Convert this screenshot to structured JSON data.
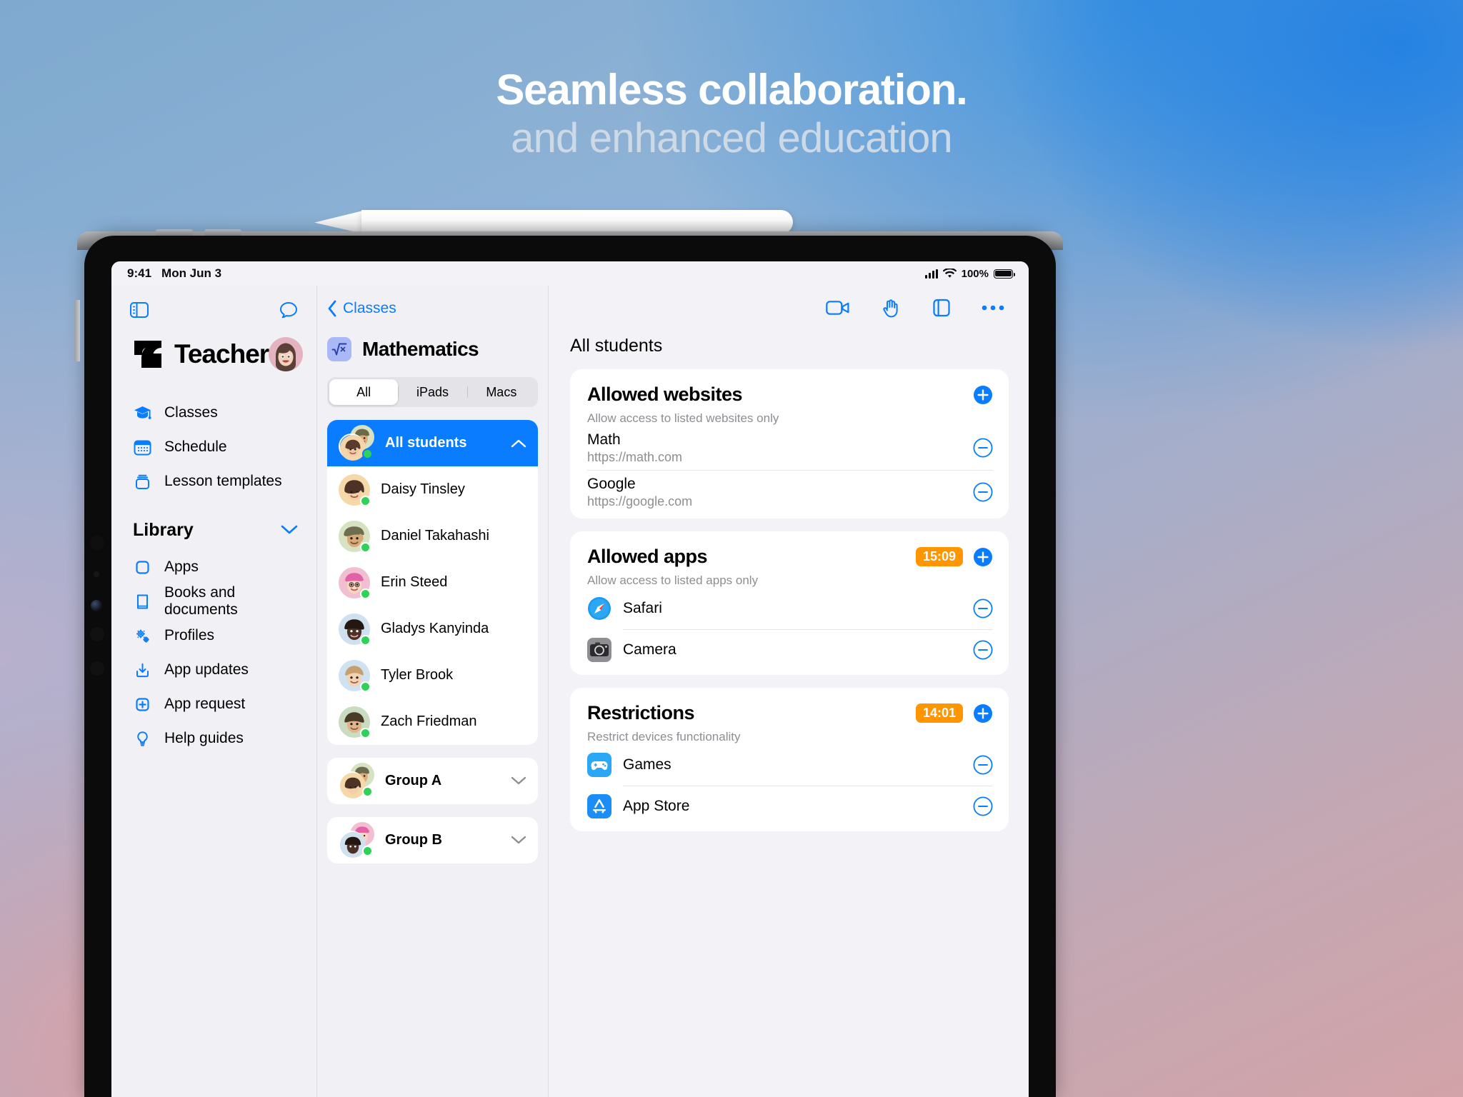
{
  "marketing": {
    "headline_line1": "Seamless collaboration.",
    "headline_line2": "and enhanced education"
  },
  "statusbar": {
    "time": "9:41",
    "date": "Mon Jun 3",
    "battery_percent": "100%",
    "wifi_icon": "wifi-icon",
    "cellular_icon": "signal-bars-icon",
    "battery_icon": "battery-full-icon"
  },
  "sidebar": {
    "toggle_icon": "sidebar-toggle-icon",
    "messages_icon": "message-bubble-icon",
    "brand_name": "Teacher",
    "brand_logo_icon": "teacher-app-logo-icon",
    "avatar_icon": "teacher-avatar",
    "items": [
      {
        "label": "Classes",
        "icon": "graduation-cap-icon"
      },
      {
        "label": "Schedule",
        "icon": "calendar-icon"
      },
      {
        "label": "Lesson templates",
        "icon": "lesson-templates-icon"
      }
    ],
    "library_header": "Library",
    "library_chevron_icon": "chevron-down-icon",
    "library_items": [
      {
        "label": "Apps",
        "icon": "app-square-icon"
      },
      {
        "label": "Books and documents",
        "icon": "book-icon"
      },
      {
        "label": "Profiles",
        "icon": "gears-icon"
      },
      {
        "label": "App updates",
        "icon": "download-box-icon"
      },
      {
        "label": "App request",
        "icon": "plus-square-icon"
      },
      {
        "label": "Help guides",
        "icon": "lightbulb-icon"
      }
    ]
  },
  "class_panel": {
    "back_label": "Classes",
    "back_icon": "chevron-left-icon",
    "class_title": "Mathematics",
    "class_icon": "square-root-icon",
    "segments": [
      {
        "label": "All",
        "selected": true
      },
      {
        "label": "iPads",
        "selected": false
      },
      {
        "label": "Macs",
        "selected": false
      }
    ],
    "all_students_row": {
      "label": "All students",
      "chevron_icon": "chevron-up-icon",
      "selected": true,
      "status": "online"
    },
    "students": [
      {
        "name": "Daisy Tinsley",
        "status": "online"
      },
      {
        "name": "Daniel Takahashi",
        "status": "online"
      },
      {
        "name": "Erin Steed",
        "status": "online"
      },
      {
        "name": "Gladys Kanyinda",
        "status": "online"
      },
      {
        "name": "Tyler Brook",
        "status": "online"
      },
      {
        "name": "Zach Friedman",
        "status": "online"
      }
    ],
    "groups": [
      {
        "name": "Group A",
        "chevron_icon": "chevron-down-icon",
        "status": "online"
      },
      {
        "name": "Group B",
        "chevron_icon": "chevron-down-icon",
        "status": "online"
      }
    ]
  },
  "detail_panel": {
    "toolbar": [
      {
        "icon": "video-camera-icon"
      },
      {
        "icon": "hand-raise-icon"
      },
      {
        "icon": "screen-share-icon"
      },
      {
        "icon": "more-ellipsis-icon"
      }
    ],
    "heading": "All students",
    "cards": [
      {
        "title": "Allowed websites",
        "subtitle": "Allow access to listed websites only",
        "badge": null,
        "add_icon": "plus-circle-icon",
        "kind": "websites",
        "entries": [
          {
            "name": "Math",
            "url": "https://math.com",
            "remove_icon": "minus-circle-icon"
          },
          {
            "name": "Google",
            "url": "https://google.com",
            "remove_icon": "minus-circle-icon"
          }
        ]
      },
      {
        "title": "Allowed apps",
        "subtitle": "Allow access to listed apps only",
        "badge": "15:09",
        "add_icon": "plus-circle-icon",
        "kind": "apps",
        "entries": [
          {
            "name": "Safari",
            "icon": "safari-icon",
            "remove_icon": "minus-circle-icon"
          },
          {
            "name": "Camera",
            "icon": "camera-icon",
            "remove_icon": "minus-circle-icon"
          }
        ]
      },
      {
        "title": "Restrictions",
        "subtitle": "Restrict devices functionality",
        "badge": "14:01",
        "add_icon": "plus-circle-icon",
        "kind": "apps",
        "entries": [
          {
            "name": "Games",
            "icon": "game-controller-icon",
            "remove_icon": "minus-circle-icon"
          },
          {
            "name": "App Store",
            "icon": "app-store-icon",
            "remove_icon": "minus-circle-icon"
          }
        ]
      }
    ]
  },
  "colors": {
    "accent_blue": "#0a7cff",
    "badge_orange": "#ff9500",
    "online_green": "#30d158"
  }
}
